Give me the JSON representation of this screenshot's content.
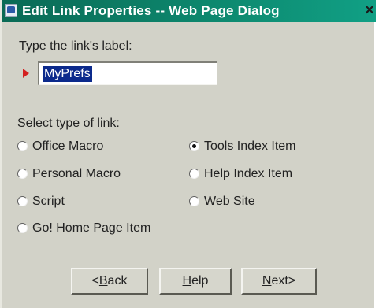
{
  "titlebar": {
    "title": "Edit Link Properties -- Web Page Dialog",
    "close": "×"
  },
  "label_field": {
    "prompt": "Type the link's label:",
    "value": "MyPrefs"
  },
  "link_type": {
    "prompt": "Select type of link:",
    "options": [
      {
        "label": "Office Macro",
        "checked": false
      },
      {
        "label": "Tools Index Item",
        "checked": true
      },
      {
        "label": "Personal Macro",
        "checked": false
      },
      {
        "label": "Help Index Item",
        "checked": false
      },
      {
        "label": "Script",
        "checked": false
      },
      {
        "label": "Web Site",
        "checked": false
      },
      {
        "label": "Go! Home Page Item",
        "checked": false
      }
    ]
  },
  "buttons": {
    "back": {
      "prefix": "<",
      "accel": "B",
      "rest": "ack"
    },
    "help": {
      "accel": "H",
      "rest": "elp"
    },
    "next": {
      "accel": "N",
      "rest": "ext>"
    }
  }
}
